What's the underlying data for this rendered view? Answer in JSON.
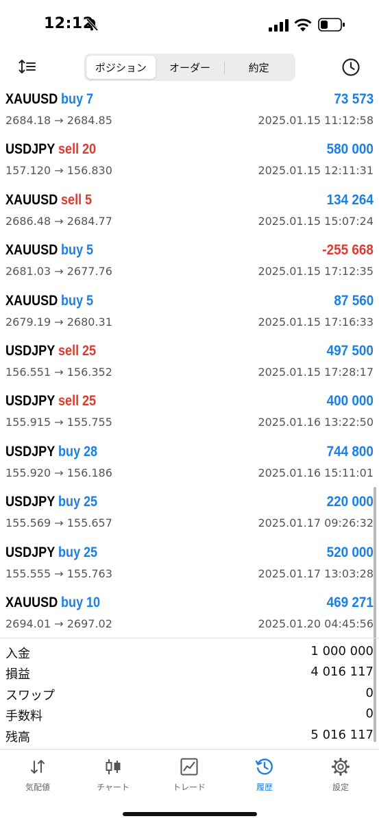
{
  "status_bar": {
    "time": "12:12"
  },
  "nav": {
    "segments": [
      "ポジション",
      "オーダー",
      "約定"
    ],
    "active_segment": 0
  },
  "deals": [
    {
      "symbol": "XAUUSD",
      "side": "buy",
      "volume": "7",
      "profit": "73 573",
      "prices": "2684.18 → 2684.85",
      "time": "2025.01.15 11:12:58"
    },
    {
      "symbol": "USDJPY",
      "side": "sell",
      "volume": "20",
      "profit": "580 000",
      "prices": "157.120 → 156.830",
      "time": "2025.01.15 12:11:31"
    },
    {
      "symbol": "XAUUSD",
      "side": "sell",
      "volume": "5",
      "profit": "134 264",
      "prices": "2686.48 → 2684.77",
      "time": "2025.01.15 15:07:24"
    },
    {
      "symbol": "XAUUSD",
      "side": "buy",
      "volume": "5",
      "profit": "-255 668",
      "prices": "2681.03 → 2677.76",
      "time": "2025.01.15 17:12:35"
    },
    {
      "symbol": "XAUUSD",
      "side": "buy",
      "volume": "5",
      "profit": "87 560",
      "prices": "2679.19 → 2680.31",
      "time": "2025.01.15 17:16:33"
    },
    {
      "symbol": "USDJPY",
      "side": "sell",
      "volume": "25",
      "profit": "497 500",
      "prices": "156.551 → 156.352",
      "time": "2025.01.15 17:28:17"
    },
    {
      "symbol": "USDJPY",
      "side": "sell",
      "volume": "25",
      "profit": "400 000",
      "prices": "155.915 → 155.755",
      "time": "2025.01.16 13:22:50"
    },
    {
      "symbol": "USDJPY",
      "side": "buy",
      "volume": "28",
      "profit": "744 800",
      "prices": "155.920 → 156.186",
      "time": "2025.01.16 15:11:01"
    },
    {
      "symbol": "USDJPY",
      "side": "buy",
      "volume": "25",
      "profit": "220 000",
      "prices": "155.569 → 155.657",
      "time": "2025.01.17 09:26:32"
    },
    {
      "symbol": "USDJPY",
      "side": "buy",
      "volume": "25",
      "profit": "520 000",
      "prices": "155.555 → 155.763",
      "time": "2025.01.17 13:03:28"
    },
    {
      "symbol": "XAUUSD",
      "side": "buy",
      "volume": "10",
      "profit": "469 271",
      "prices": "2694.01 → 2697.02",
      "time": "2025.01.20 04:45:56"
    }
  ],
  "summary": [
    {
      "label": "入金",
      "value": "1 000 000"
    },
    {
      "label": "損益",
      "value": "4 016 117"
    },
    {
      "label": "スワップ",
      "value": "0"
    },
    {
      "label": "手数料",
      "value": "0"
    },
    {
      "label": "残高",
      "value": "5 016 117"
    }
  ],
  "tabs": [
    {
      "label": "気配値",
      "icon": "quotes-icon"
    },
    {
      "label": "チャート",
      "icon": "chart-icon"
    },
    {
      "label": "トレード",
      "icon": "trade-icon"
    },
    {
      "label": "履歴",
      "icon": "history-icon"
    },
    {
      "label": "設定",
      "icon": "settings-icon"
    }
  ],
  "active_tab": 3,
  "colors": {
    "accent": "#1a7fe6",
    "sell": "#e0392f",
    "buy": "#1a7fe6"
  }
}
